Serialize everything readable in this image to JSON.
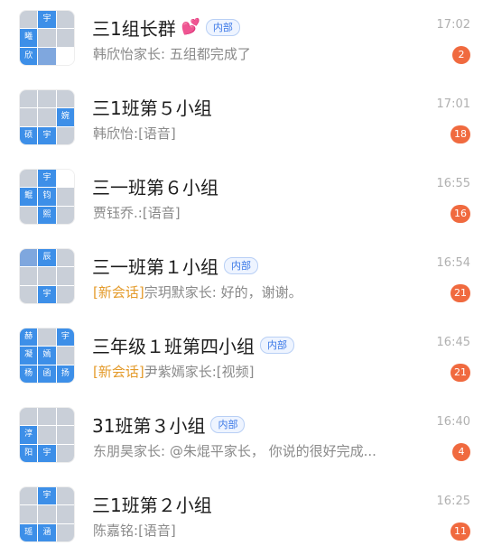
{
  "conversations": [
    {
      "name": "三1组长群",
      "emoji": "💕",
      "tag": "内部",
      "time": "17:02",
      "highlight": "",
      "sender": "韩欣怡家长",
      "message": "五组都完成了",
      "unread": "2",
      "avatar_tiles": [
        "",
        "宇",
        "",
        "曦",
        "",
        "",
        "欣",
        "",
        ""
      ]
    },
    {
      "name": "三1班第５小组",
      "emoji": "",
      "tag": "",
      "time": "17:01",
      "highlight": "",
      "sender": "韩欣怡",
      "message": "[语音]",
      "unread": "18",
      "avatar_tiles": [
        "",
        "",
        "",
        "",
        "",
        "婉",
        "硕",
        "宇",
        ""
      ]
    },
    {
      "name": "三一班第６小组",
      "emoji": "",
      "tag": "",
      "time": "16:55",
      "highlight": "",
      "sender": "贾钰乔.",
      "message": "[语音]",
      "unread": "16",
      "avatar_tiles": [
        "",
        "宇",
        "",
        "鲲",
        "钧",
        "",
        "",
        "熙",
        ""
      ]
    },
    {
      "name": "三一班第１小组",
      "emoji": "",
      "tag": "内部",
      "time": "16:54",
      "highlight": "[新会话]",
      "sender": "宗玥默家长",
      "message": "好的，谢谢。",
      "unread": "21",
      "avatar_tiles": [
        "",
        "辰",
        "",
        "",
        "",
        "",
        "",
        "宇",
        ""
      ]
    },
    {
      "name": "三年级１班第四小组",
      "emoji": "",
      "tag": "内部",
      "time": "16:45",
      "highlight": "[新会话]",
      "sender": "尹紫嫣家长",
      "message": "[视频]",
      "unread": "21",
      "avatar_tiles": [
        "赫",
        "",
        "宇",
        "凝",
        "嫣",
        "",
        "杨",
        "函",
        "扬"
      ]
    },
    {
      "name": "31班第３小组",
      "emoji": "",
      "tag": "内部",
      "time": "16:40",
      "highlight": "",
      "sender": "东朋昊家长",
      "message": "@朱焜平家长， 你说的很好完成...",
      "unread": "4",
      "avatar_tiles": [
        "",
        "",
        "",
        "淳",
        "",
        "",
        "阳",
        "宇",
        ""
      ]
    },
    {
      "name": "三1班第２小组",
      "emoji": "",
      "tag": "",
      "time": "16:25",
      "highlight": "",
      "sender": "陈嘉铭",
      "message": "[语音]",
      "unread": "11",
      "avatar_tiles": [
        "",
        "宇",
        "",
        "",
        "",
        "",
        "瑶",
        "涵",
        ""
      ]
    }
  ],
  "colors": {
    "badge": "#f06a3f",
    "tag_text": "#3b78e7",
    "highlight": "#e49b2b",
    "avatar_blue": "#3d8fe8"
  }
}
